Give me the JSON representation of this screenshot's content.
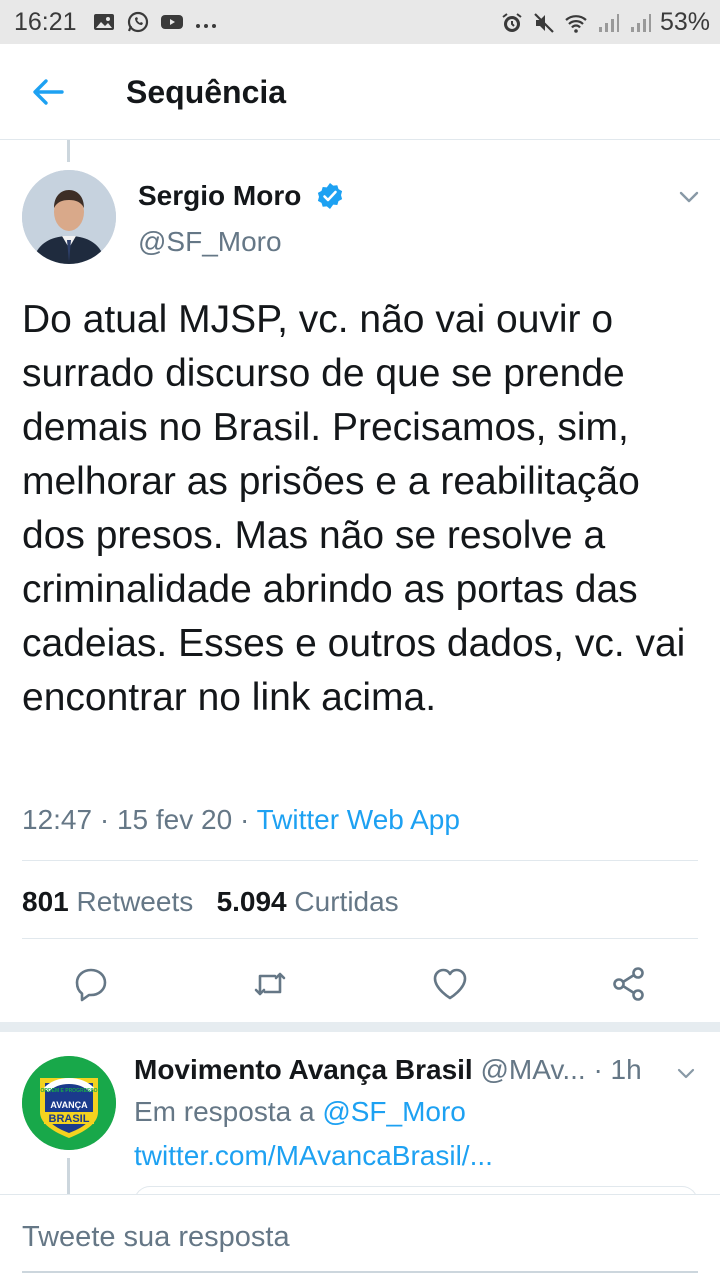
{
  "status_bar": {
    "time": "16:21",
    "battery": "53%",
    "left_icons": [
      "gallery-icon",
      "whatsapp-icon",
      "youtube-icon",
      "more-dots-icon"
    ],
    "right_icons": [
      "alarm-icon",
      "mute-icon",
      "wifi-icon",
      "signal-icon",
      "signal-icon"
    ]
  },
  "header": {
    "title": "Sequência",
    "back_icon": "arrow-left-icon"
  },
  "tweet": {
    "author_name": "Sergio Moro",
    "author_handle": "@SF_Moro",
    "verified": true,
    "text": "Do atual MJSP, vc. não vai ouvir o surrado discurso de que se prende demais no Brasil. Precisamos, sim, melhorar as prisões e a reabilitação dos presos. Mas não se resolve a criminalidade abrindo as portas das cadeias. Esses e outros dados, vc. vai encontrar no link acima.",
    "time": "12:47",
    "date": "15 fev 20",
    "source": "Twitter Web App",
    "separator": " · ",
    "retweets_count": "801",
    "retweets_label": "Retweets",
    "likes_count": "5.094",
    "likes_label": "Curtidas",
    "actions": [
      "reply-icon",
      "retweet-icon",
      "like-icon",
      "share-icon"
    ]
  },
  "reply": {
    "author_name": "Movimento Avança Brasil",
    "author_handle": "@MAv...",
    "time": "· 1h",
    "in_reply_prefix": "Em resposta a",
    "in_reply_mention": "@SF_Moro",
    "link": "twitter.com/MAvancaBrasil/...",
    "avatar_text_top": "ORDEM E PROGRESSO",
    "avatar_text_mid": "AVANÇA",
    "avatar_text_bottom": "BRASIL"
  },
  "composer": {
    "placeholder": "Tweete sua resposta"
  },
  "colors": {
    "accent": "#1da1f2",
    "text": "#14171a",
    "secondary": "#657786",
    "border": "#e1e8ed"
  }
}
